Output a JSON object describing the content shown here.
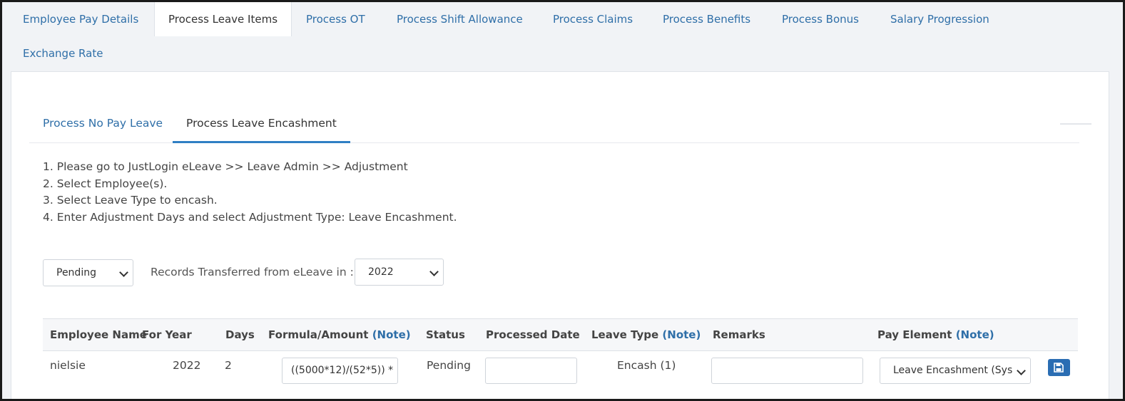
{
  "top_tabs": [
    {
      "label": "Employee Pay Details"
    },
    {
      "label": "Process Leave Items"
    },
    {
      "label": "Process OT"
    },
    {
      "label": "Process Shift Allowance"
    },
    {
      "label": "Process Claims"
    },
    {
      "label": "Process Benefits"
    },
    {
      "label": "Process Bonus"
    },
    {
      "label": "Salary Progression"
    },
    {
      "label": "Exchange Rate"
    }
  ],
  "sub_tabs": [
    {
      "label": "Process No Pay Leave"
    },
    {
      "label": "Process Leave Encashment"
    }
  ],
  "instructions": [
    "1. Please go to JustLogin eLeave >> Leave Admin >> Adjustment",
    "2. Select Employee(s).",
    "3. Select Leave Type to encash.",
    "4. Enter Adjustment Days and select Adjustment Type: Leave Encashment."
  ],
  "filters": {
    "status_value": "Pending",
    "records_label": "Records Transferred from eLeave in :",
    "year_value": "2022"
  },
  "table": {
    "headers": {
      "employee_name": "Employee Name",
      "for_year": "For Year",
      "days": "Days",
      "formula": "Formula/Amount",
      "formula_note": "(Note)",
      "status": "Status",
      "processed_date": "Processed Date",
      "leave_type": "Leave Type",
      "leave_type_note": "(Note)",
      "remarks": "Remarks",
      "pay_element": "Pay Element",
      "pay_element_note": "(Note)"
    },
    "rows": [
      {
        "employee_name": "nielsie",
        "for_year": "2022",
        "days": "2",
        "formula": "((5000*12)/(52*5)) *",
        "status": "Pending",
        "processed_date": "",
        "leave_type": "Encash (1)",
        "remarks": "",
        "pay_element": "Leave Encashment (Sys"
      }
    ]
  },
  "colors": {
    "link": "#2f6fa8",
    "accent": "#2f7fc4",
    "button": "#2a6db3"
  }
}
